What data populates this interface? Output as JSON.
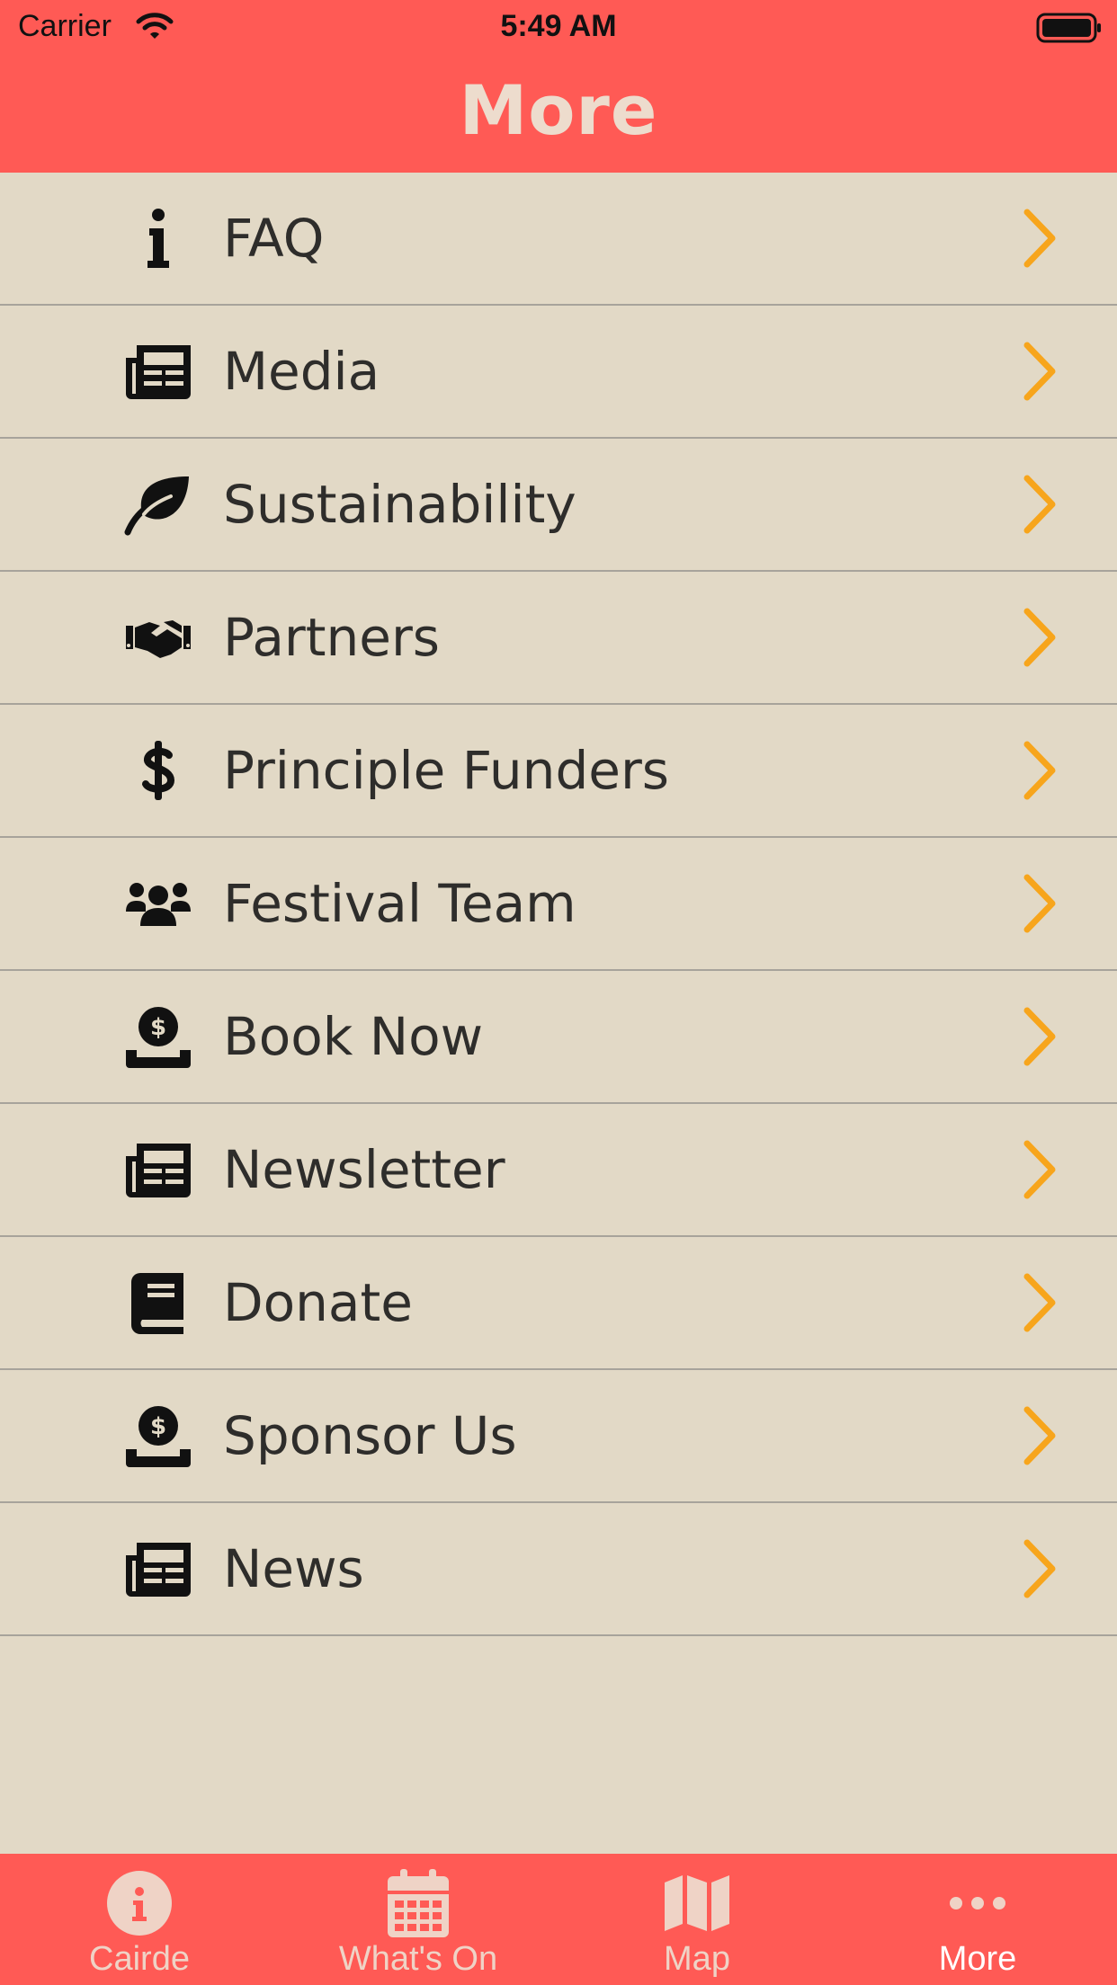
{
  "status_bar": {
    "carrier": "Carrier",
    "time": "5:49 AM",
    "icons": [
      "wifi-icon",
      "battery-icon"
    ]
  },
  "header": {
    "title": "More"
  },
  "colors": {
    "header_bg": "#ff5a55",
    "page_bg": "#e2d9c6",
    "chevron": "#f7a51c",
    "text": "#2e2d2b",
    "title": "#eddccd"
  },
  "menu": {
    "items": [
      {
        "label": "FAQ",
        "icon": "info-icon"
      },
      {
        "label": "Media",
        "icon": "newspaper-icon"
      },
      {
        "label": "Sustainability",
        "icon": "leaf-icon"
      },
      {
        "label": "Partners",
        "icon": "handshake-icon"
      },
      {
        "label": "Principle Funders",
        "icon": "dollar-icon"
      },
      {
        "label": "Festival Team",
        "icon": "users-icon"
      },
      {
        "label": "Book Now",
        "icon": "donate-coin-icon"
      },
      {
        "label": "Newsletter",
        "icon": "newspaper-icon"
      },
      {
        "label": "Donate",
        "icon": "book-icon"
      },
      {
        "label": "Sponsor Us",
        "icon": "donate-coin-icon"
      },
      {
        "label": "News",
        "icon": "newspaper-icon"
      }
    ]
  },
  "tabbar": {
    "tabs": [
      {
        "label": "Cairde",
        "icon": "info-circle-icon",
        "active": false
      },
      {
        "label": "What's On",
        "icon": "calendar-icon",
        "active": false
      },
      {
        "label": "Map",
        "icon": "map-icon",
        "active": false
      },
      {
        "label": "More",
        "icon": "ellipsis-icon",
        "active": true
      }
    ]
  }
}
